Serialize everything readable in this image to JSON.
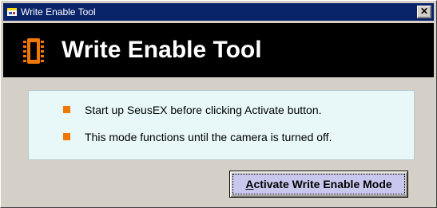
{
  "window": {
    "title": "Write Enable Tool",
    "close_glyph": "✕"
  },
  "banner": {
    "title": "Write Enable Tool",
    "icon": "chip-icon",
    "icon_color": "#f07800"
  },
  "info": {
    "bullets": [
      "Start up SeusEX before clicking Activate button.",
      "This mode functions until the camera is turned off."
    ],
    "bullet_color": "#f07800",
    "background": "#e8f8f8"
  },
  "actions": {
    "activate": {
      "mnemonic": "A",
      "label_rest": "ctivate Write Enable Mode"
    }
  },
  "colors": {
    "titlebar": "#0a246a",
    "banner": "#000000",
    "window": "#d4d0c8",
    "button_face": "#c8c8ee"
  }
}
